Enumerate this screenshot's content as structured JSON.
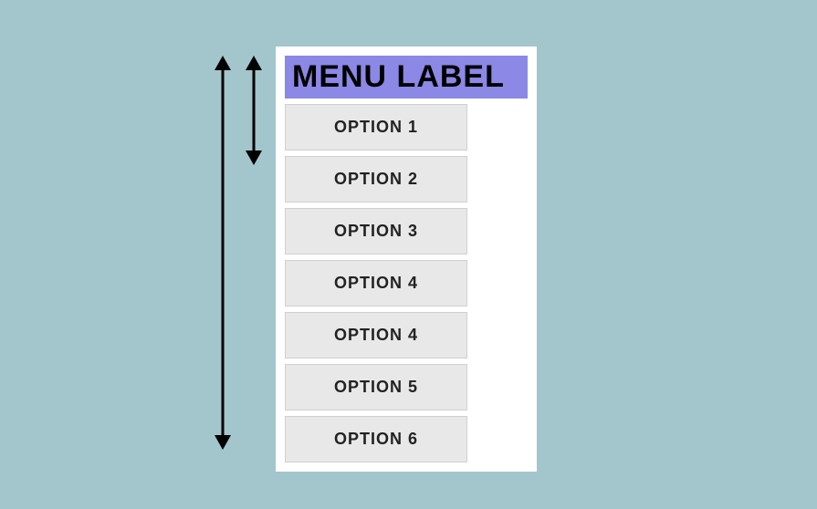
{
  "menu": {
    "label": "MENU LABEL",
    "options": [
      "OPTION 1",
      "OPTION 2",
      "OPTION 3",
      "OPTION 4",
      "OPTION 4",
      "OPTION 5",
      "OPTION 6"
    ]
  },
  "arrows": {
    "tall": {
      "spans": "full-menu-height"
    },
    "short": {
      "spans": "label-plus-two-options"
    }
  }
}
